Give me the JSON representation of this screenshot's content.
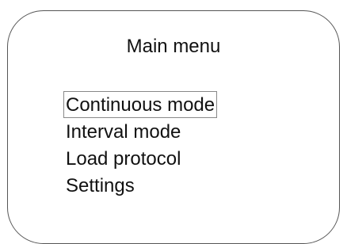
{
  "screen": {
    "title": "Main menu"
  },
  "menu": {
    "items": [
      {
        "label": "Continuous mode",
        "selected": true
      },
      {
        "label": "Interval mode",
        "selected": false
      },
      {
        "label": "Load protocol",
        "selected": false
      },
      {
        "label": "Settings",
        "selected": false
      }
    ]
  }
}
